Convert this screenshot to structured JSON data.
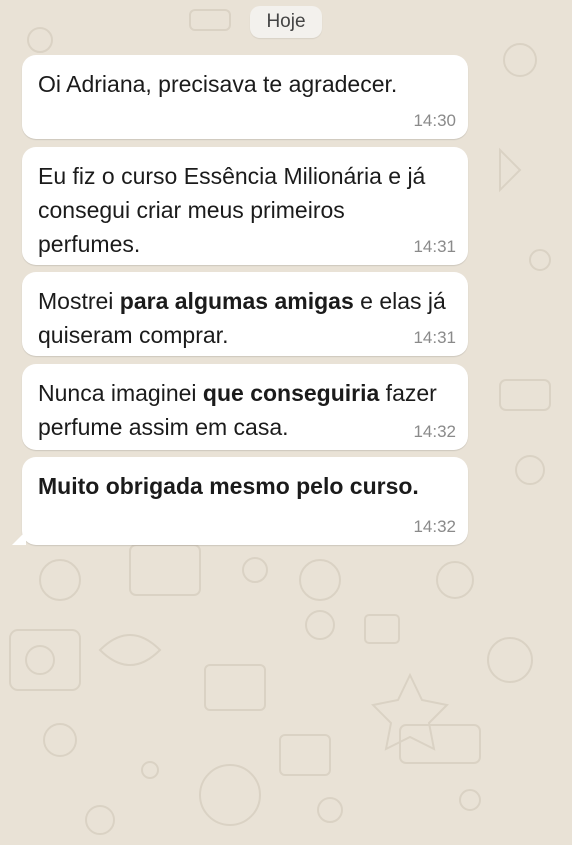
{
  "chat": {
    "date_label": "Hoje",
    "messages": [
      {
        "parts": [
          {
            "text": "Oi Adriana, precisava te agradecer.",
            "bold": false
          }
        ],
        "time": "14:30"
      },
      {
        "parts": [
          {
            "text": "Eu fiz o curso Essência Milionária e já consegui criar meus primeiros perfumes.",
            "bold": false
          }
        ],
        "time": "14:31"
      },
      {
        "parts": [
          {
            "text": "Mostrei ",
            "bold": false
          },
          {
            "text": "para algumas amigas",
            "bold": true
          },
          {
            "text": " e elas já quiseram comprar.",
            "bold": false
          }
        ],
        "time": "14:31"
      },
      {
        "parts": [
          {
            "text": "Nunca imaginei ",
            "bold": false
          },
          {
            "text": "que conseguiria",
            "bold": true
          },
          {
            "text": " fazer perfume assim em casa.",
            "bold": false
          }
        ],
        "time": "14:32"
      },
      {
        "parts": [
          {
            "text": "Muito obrigada mesmo pelo curso.",
            "bold": true
          }
        ],
        "time": "14:32"
      }
    ],
    "colors": {
      "background": "#e9e2d6",
      "bubble": "#ffffff",
      "time_text": "#8a8a8a"
    },
    "icons": [
      "doodle-wallpaper"
    ]
  }
}
